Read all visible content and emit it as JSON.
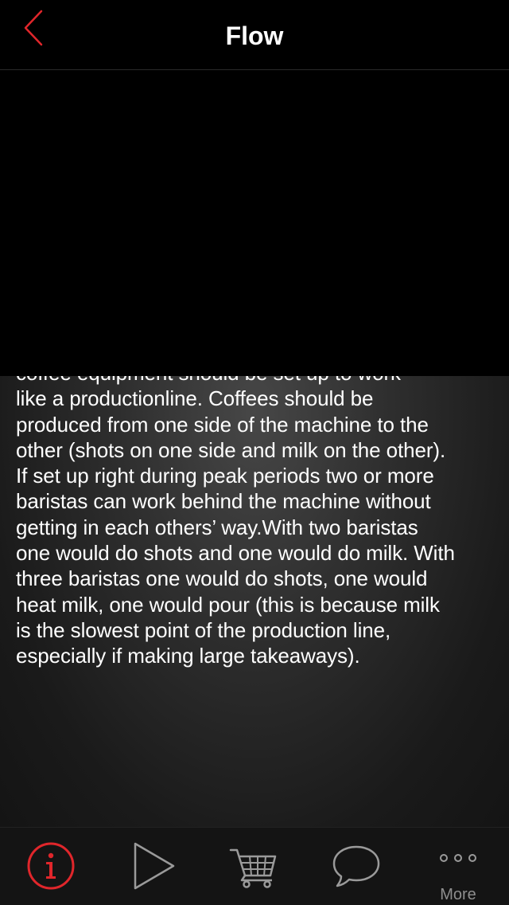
{
  "nav": {
    "title": "Flow",
    "back_icon": "chevron-left-icon"
  },
  "content": {
    "body": "coffee equipment should be set up to work\nlike a productionline. Coffees should be\nproduced from one side of the machine to the\nother (shots on one side and milk on the other).\nIf set up right during peak periods two or more\nbaristas can work behind the machine without\ngetting in each others’ way.With two baristas\none would do shots and one would do milk. With\nthree baristas one would do shots, one would\nheat milk, one would pour (this is because milk\nis the slowest point of the production line,\nespecially if making large takeaways)."
  },
  "tab_bar": {
    "items": [
      {
        "icon": "info-icon",
        "selected": true
      },
      {
        "icon": "play-icon",
        "selected": false
      },
      {
        "icon": "cart-icon",
        "selected": false
      },
      {
        "icon": "speech-bubble-icon",
        "selected": false
      },
      {
        "icon": "more-icon",
        "label": "More",
        "selected": false
      }
    ]
  },
  "colors": {
    "accent": "#e0262b",
    "background": "#000000",
    "tab_icon": "#9a9a9a",
    "text": "#ffffff"
  }
}
